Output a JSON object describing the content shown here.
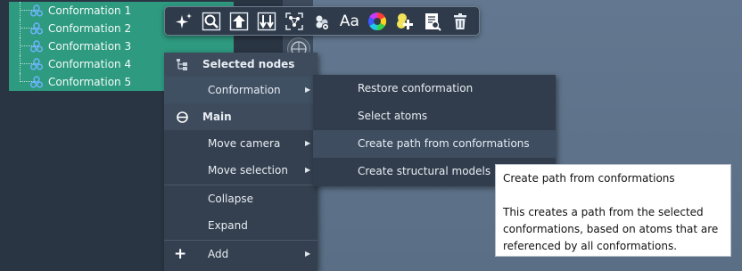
{
  "tree": {
    "items": [
      {
        "label": "Conformation 1"
      },
      {
        "label": "Conformation 2"
      },
      {
        "label": "Conformation 3"
      },
      {
        "label": "Conformation 4"
      },
      {
        "label": "Conformation 5"
      }
    ],
    "selection_color": "#2e9a80"
  },
  "toolbar": {
    "tools": [
      {
        "icon": "sparkle-icon"
      },
      {
        "icon": "zoom-icon"
      },
      {
        "icon": "move-up-icon"
      },
      {
        "icon": "sort-icon"
      },
      {
        "icon": "fit-selection-icon"
      },
      {
        "icon": "visibility-icon"
      },
      {
        "icon": "text-icon",
        "label": "Aa"
      },
      {
        "icon": "color-wheel-icon"
      },
      {
        "icon": "add-visual-model-icon"
      },
      {
        "icon": "inspect-icon"
      },
      {
        "icon": "delete-icon"
      }
    ]
  },
  "context_menu": {
    "selected_nodes_header": "Selected nodes",
    "conformation": "Conformation",
    "main_header": "Main",
    "move_camera": "Move camera",
    "move_selection": "Move selection",
    "collapse": "Collapse",
    "expand": "Expand",
    "add": "Add",
    "submenu_arrow": "▶",
    "add_glyph": "+"
  },
  "submenu": {
    "items": [
      {
        "label": "Restore conformation"
      },
      {
        "label": "Select atoms"
      },
      {
        "label": "Create path from conformations"
      },
      {
        "label": "Create structural models"
      }
    ]
  },
  "tooltip": {
    "title": "Create path from conformations",
    "body": "This creates a path from the selected conformations, based on atoms that are referenced by all conformations."
  }
}
